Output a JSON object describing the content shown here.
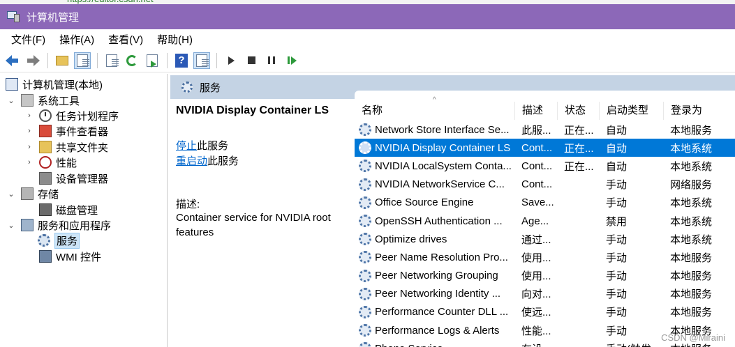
{
  "window": {
    "title": "计算机管理"
  },
  "menu": [
    "文件(F)",
    "操作(A)",
    "查看(V)",
    "帮助(H)"
  ],
  "toolbar": {
    "icons": [
      "back-arrow-icon",
      "forward-arrow-icon",
      "up-folder-icon",
      "show-hide-tree-icon",
      "properties-icon",
      "refresh-icon",
      "export-list-icon",
      "help-icon",
      "show-action-pane-icon",
      "start-service-icon",
      "stop-service-icon",
      "pause-service-icon",
      "restart-service-icon"
    ]
  },
  "tree": {
    "root": "计算机管理(本地)",
    "system_tools": "系统工具",
    "task_scheduler": "任务计划程序",
    "event_viewer": "事件查看器",
    "shared_folders": "共享文件夹",
    "performance": "性能",
    "device_manager": "设备管理器",
    "storage": "存储",
    "disk_management": "磁盘管理",
    "services_apps": "服务和应用程序",
    "services": "服务",
    "wmi": "WMI 控件"
  },
  "panel": {
    "title": "服务"
  },
  "details": {
    "service_name": "NVIDIA Display Container LS",
    "stop_link": "停止",
    "stop_suffix": "此服务",
    "restart_link": "重启动",
    "restart_suffix": "此服务",
    "description_label": "描述:",
    "description": "Container service for NVIDIA root features"
  },
  "columns": {
    "name": "名称",
    "description": "描述",
    "status": "状态",
    "startup": "启动类型",
    "logon": "登录为"
  },
  "services": [
    {
      "name": "Network Store Interface Se...",
      "description": "此服...",
      "status": "正在...",
      "startup": "自动",
      "logon": "本地服务"
    },
    {
      "name": "NVIDIA Display Container LS",
      "description": "Cont...",
      "status": "正在...",
      "startup": "自动",
      "logon": "本地系统",
      "selected": true
    },
    {
      "name": "NVIDIA LocalSystem Conta...",
      "description": "Cont...",
      "status": "正在...",
      "startup": "自动",
      "logon": "本地系统"
    },
    {
      "name": "NVIDIA NetworkService C...",
      "description": "Cont...",
      "status": "",
      "startup": "手动",
      "logon": "网络服务"
    },
    {
      "name": "Office  Source Engine",
      "description": "Save...",
      "status": "",
      "startup": "手动",
      "logon": "本地系统"
    },
    {
      "name": "OpenSSH Authentication ...",
      "description": "Age...",
      "status": "",
      "startup": "禁用",
      "logon": "本地系统"
    },
    {
      "name": "Optimize drives",
      "description": "通过...",
      "status": "",
      "startup": "手动",
      "logon": "本地系统"
    },
    {
      "name": "Peer Name Resolution Pro...",
      "description": "使用...",
      "status": "",
      "startup": "手动",
      "logon": "本地服务"
    },
    {
      "name": "Peer Networking Grouping",
      "description": "使用...",
      "status": "",
      "startup": "手动",
      "logon": "本地服务"
    },
    {
      "name": "Peer Networking Identity ...",
      "description": "向对...",
      "status": "",
      "startup": "手动",
      "logon": "本地服务"
    },
    {
      "name": "Performance Counter DLL ...",
      "description": "使远...",
      "status": "",
      "startup": "手动",
      "logon": "本地服务"
    },
    {
      "name": "Performance Logs & Alerts",
      "description": "性能...",
      "status": "",
      "startup": "手动",
      "logon": "本地服务"
    },
    {
      "name": "Phone Service",
      "description": "在设...",
      "status": "",
      "startup": "手动(触发...",
      "logon": "本地服务"
    }
  ],
  "watermark": "CSDN @Miraini"
}
